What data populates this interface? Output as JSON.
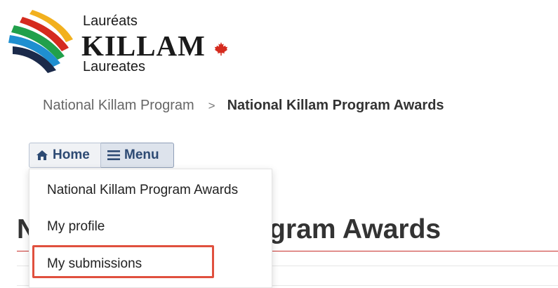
{
  "logo": {
    "text_fr": "Lauréats",
    "text_main": "KILLAM",
    "text_en": "Laureates",
    "icon": "maple-leaf-icon",
    "leaf_color": "#d52b1e"
  },
  "breadcrumb": {
    "items": [
      "National Killam Program",
      "National Killam Program Awards"
    ],
    "separator": ">"
  },
  "nav": {
    "home_label": "Home",
    "menu_label": "Menu",
    "home_icon": "home-icon",
    "menu_icon": "hamburger-icon"
  },
  "menu": {
    "items": [
      "National Killam Program Awards",
      "My profile",
      "My submissions"
    ],
    "highlighted_item": "My submissions",
    "highlight_color": "#e0503e"
  },
  "page": {
    "title_visible": "N",
    "title_tail": "gram Awards",
    "title_rule_color": "#c9302c"
  },
  "colors": {
    "nav_text": "#2d4a73",
    "nav_bg": "#f0f2f5"
  }
}
